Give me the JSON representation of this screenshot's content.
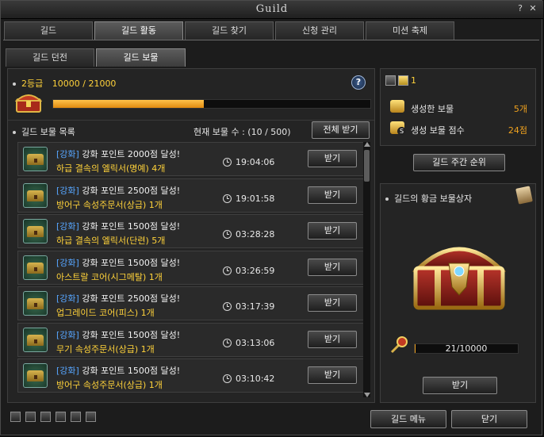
{
  "window": {
    "title": "Guild",
    "help_label": "?",
    "close_label": "✕"
  },
  "main_tabs": [
    "길드",
    "길드 활동",
    "길드 찾기",
    "신청 관리",
    "미션 축제"
  ],
  "sub_tabs": [
    "길드 던전",
    "길드 보물"
  ],
  "grade": {
    "label": "2등급",
    "progress_text": "10000 / 21000",
    "progress_current": 10000,
    "progress_max": 21000,
    "help_label": "?"
  },
  "list": {
    "title": "길드 보물 목록",
    "count_label": "현재 보물 수 : (10 / 500)",
    "receive_all_label": "전체 받기",
    "items": [
      {
        "tag": "[강화]",
        "desc": "강화 포인트 2000점 달성!",
        "reward": "하급 결속의 엘릭서(명예) 4개",
        "time": "19:04:06",
        "button": "받기"
      },
      {
        "tag": "[강화]",
        "desc": "강화 포인트 2500점 달성!",
        "reward": "방어구 속성주문서(상급) 1개",
        "time": "19:01:58",
        "button": "받기"
      },
      {
        "tag": "[강화]",
        "desc": "강화 포인트 1500점 달성!",
        "reward": "하급 결속의 엘릭서(단련) 5개",
        "time": "03:28:28",
        "button": "받기"
      },
      {
        "tag": "[강화]",
        "desc": "강화 포인트 1500점 달성!",
        "reward": "아스트랄 코어(시그메탈) 1개",
        "time": "03:26:59",
        "button": "받기"
      },
      {
        "tag": "[강화]",
        "desc": "강화 포인트 2500점 달성!",
        "reward": "업그레이드 코어(피스) 1개",
        "time": "03:17:39",
        "button": "받기"
      },
      {
        "tag": "[강화]",
        "desc": "강화 포인트 1500점 달성!",
        "reward": "무기 속성주문서(상급) 1개",
        "time": "03:13:06",
        "button": "받기"
      },
      {
        "tag": "[강화]",
        "desc": "강화 포인트 1500점 달성!",
        "reward": "방어구 속성주문서(상급) 1개",
        "time": "03:10:42",
        "button": "받기"
      }
    ]
  },
  "stats": {
    "top_value": "1",
    "created_label": "생성한 보물",
    "created_value": "5개",
    "score_label": "생성 보물 점수",
    "score_value": "24점",
    "ranking_button": "길드 주간 순위"
  },
  "golden_chest": {
    "title": "길드의 황금 보물상자",
    "progress_text": "21/10000",
    "progress_current": 21,
    "progress_max": 10000,
    "receive_label": "받기"
  },
  "footer": {
    "menu_label": "길드 메뉴",
    "close_label": "닫기"
  },
  "colors": {
    "accent_gold": "#ffd23a",
    "tag_blue": "#57a6ff",
    "progress_orange": "#f0a21e"
  }
}
